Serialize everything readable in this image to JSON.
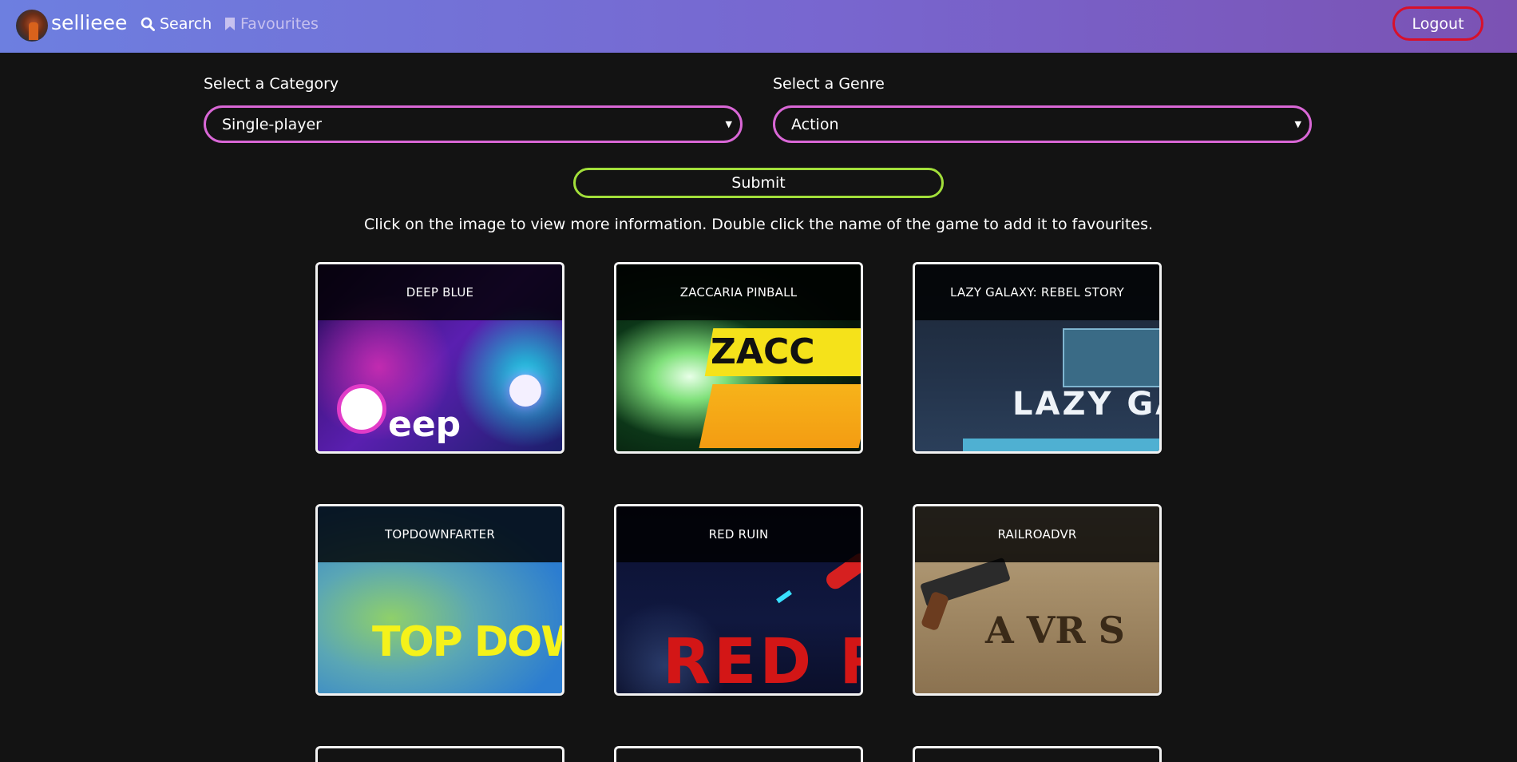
{
  "nav": {
    "brand": "sellieee",
    "search_label": "Search",
    "favourites_label": "Favourites",
    "logout_label": "Logout",
    "icons": {
      "search": "search-icon",
      "favourites": "bookmark-icon",
      "avatar": "avatar"
    }
  },
  "filters": {
    "category_label": "Select a Category",
    "category_value": "Single-player",
    "genre_label": "Select a Genre",
    "genre_value": "Action",
    "submit_label": "Submit"
  },
  "hint": "Click on the image to view more information. Double click the name of the game to add it to favourites.",
  "games": [
    {
      "title": "DEEP BLUE",
      "art_text": "eep"
    },
    {
      "title": "ZACCARIA PINBALL",
      "art_text": "ZACC"
    },
    {
      "title": "LAZY GALAXY: REBEL STORY",
      "art_text": "LAZY GA"
    },
    {
      "title": "TOPDOWNFARTER",
      "art_text": "TOP DOWN"
    },
    {
      "title": "RED RUIN",
      "art_text": "RED R"
    },
    {
      "title": "RAILROADVR",
      "art_text": "A VR S"
    }
  ],
  "colors": {
    "background": "#131313",
    "nav_gradient_start": "#6d7fe0",
    "nav_gradient_end": "#7b52b3",
    "logout_border": "#d8102a",
    "select_border": "#d967d6",
    "submit_border": "#a2df3a"
  }
}
